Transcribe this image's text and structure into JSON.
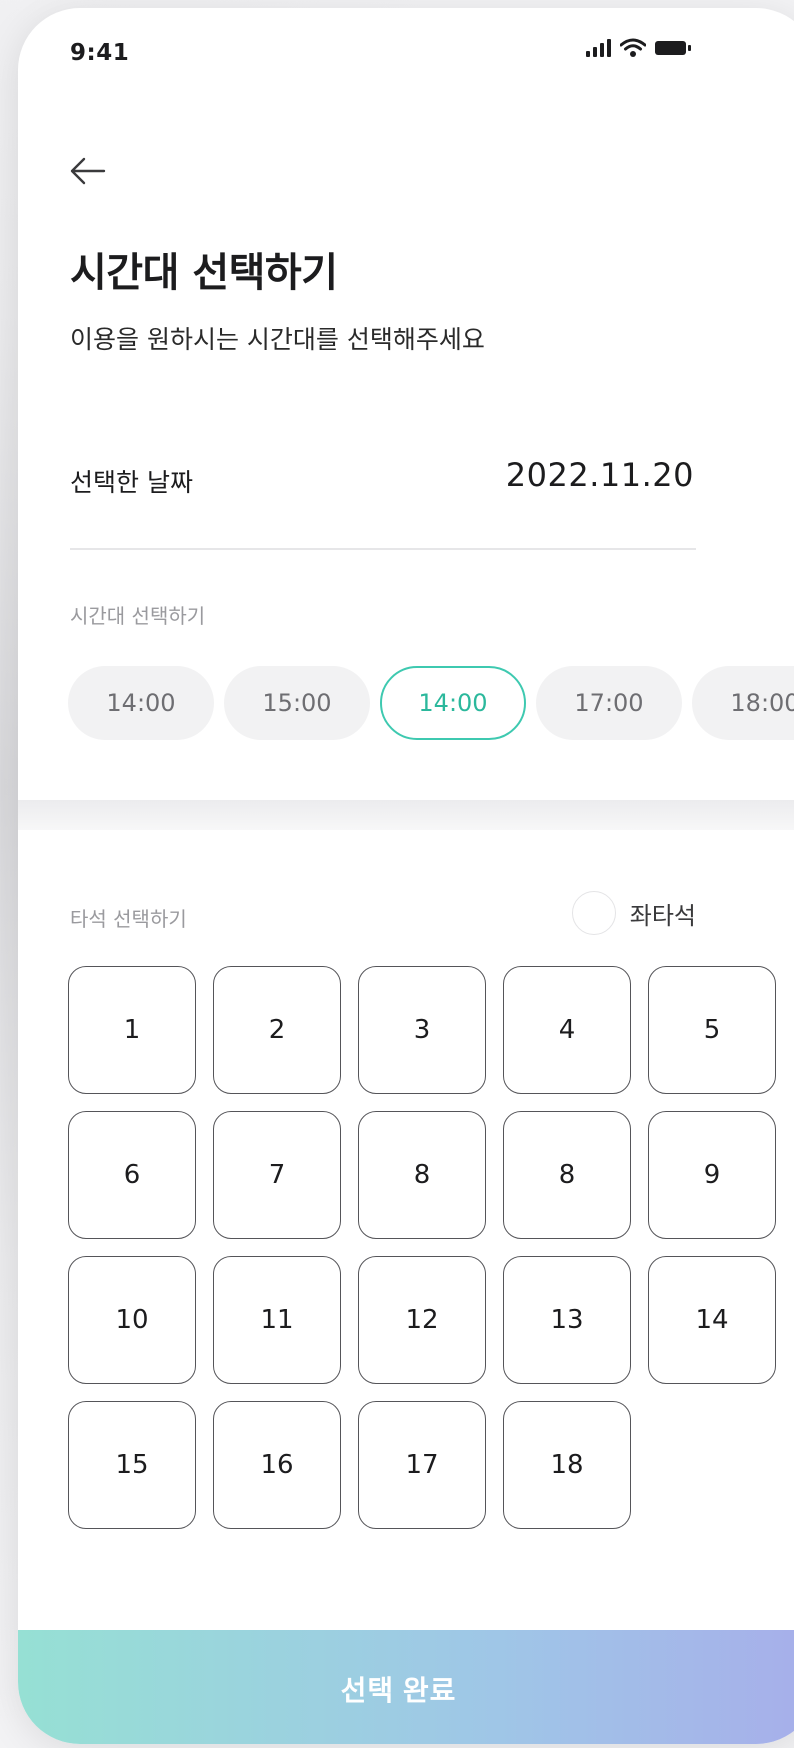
{
  "status_bar": {
    "time": "9:41",
    "icons": [
      "signal-icon",
      "wifi-icon",
      "battery-icon"
    ]
  },
  "header": {
    "back_icon": "arrow-left-icon",
    "title": "시간대 선택하기",
    "subtitle": "이용을 원하시는 시간대를 선택해주세요"
  },
  "date": {
    "label": "선택한 날짜",
    "value": "2022.11.20"
  },
  "time_section": {
    "label": "시간대 선택하기",
    "slots": [
      {
        "label": "14:00",
        "selected": false
      },
      {
        "label": "15:00",
        "selected": false
      },
      {
        "label": "14:00",
        "selected": true
      },
      {
        "label": "17:00",
        "selected": false
      },
      {
        "label": "18:00",
        "selected": false
      }
    ]
  },
  "seat_section": {
    "label": "타석 선택하기",
    "left_seat_option": "좌타석",
    "seats": [
      "1",
      "2",
      "3",
      "4",
      "5",
      "6",
      "7",
      "8",
      "8",
      "9",
      "10",
      "11",
      "12",
      "13",
      "14",
      "15",
      "16",
      "17",
      "18"
    ]
  },
  "complete_button": {
    "label": "선택 완료"
  },
  "colors": {
    "accent": "#3ec9b0",
    "button_gradient_start": "#96e0d4",
    "button_gradient_end": "#a7aeea"
  }
}
